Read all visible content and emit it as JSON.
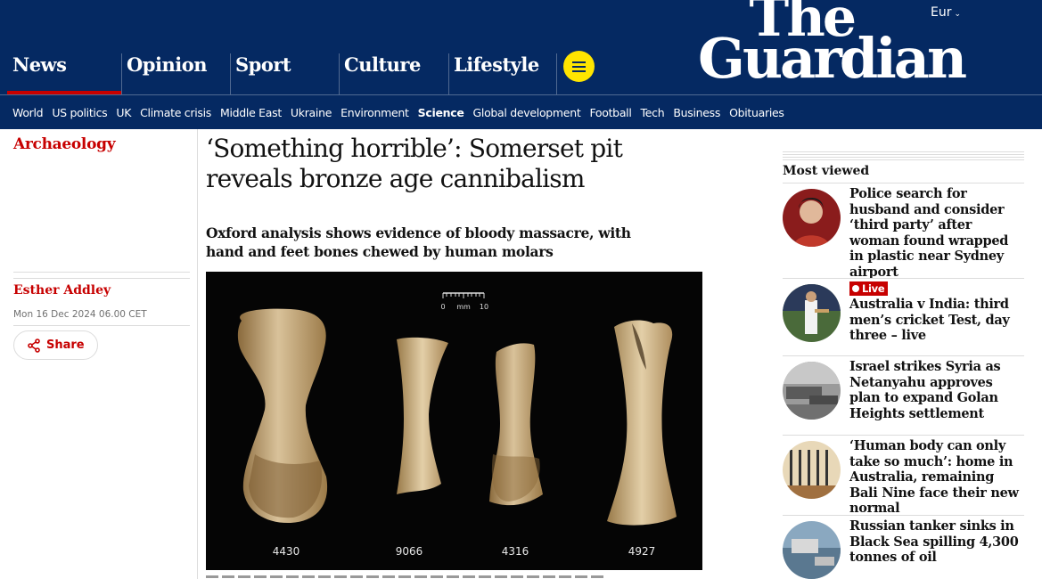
{
  "header": {
    "pillars": [
      "News",
      "Opinion",
      "Sport",
      "Culture",
      "Lifestyle"
    ],
    "edition": "Eur",
    "logo_line1": "The",
    "logo_line2": "Guardian"
  },
  "subnav": [
    "World",
    "US politics",
    "UK",
    "Climate crisis",
    "Middle East",
    "Ukraine",
    "Environment",
    "Science",
    "Global development",
    "Football",
    "Tech",
    "Business",
    "Obituaries"
  ],
  "subnav_active": "Science",
  "article": {
    "section": "Archaeology",
    "headline": "‘Something horrible’: Somerset pit reveals bronze age cannibalism",
    "standfirst": "Oxford analysis shows evidence of bloody massacre, with hand and feet bones chewed by human molars",
    "author": "Esther Addley",
    "date": "Mon 16 Dec 2024 06.00 CET",
    "share_label": "Share",
    "image": {
      "scale_min": "0",
      "scale_unit": "mm",
      "scale_max": "10",
      "bone_labels": [
        "4430",
        "9066",
        "4316",
        "4927"
      ]
    }
  },
  "most_viewed": {
    "title": "Most viewed",
    "live_label": "Live",
    "items": [
      {
        "headline": "Police search for husband and consider ‘third party’ after woman found wrapped in plastic near Sydney airport",
        "live": false
      },
      {
        "headline": "Australia v India: third men’s cricket Test, day three – live",
        "live": true
      },
      {
        "headline": "Israel strikes Syria as Netanyahu approves plan to expand Golan Heights settlement",
        "live": false
      },
      {
        "headline": "‘Human body can only take so much’: home in Australia, remaining Bali Nine face their new normal",
        "live": false
      },
      {
        "headline": "Russian tanker sinks in Black Sea spilling 4,300 tonnes of oil",
        "live": false
      }
    ]
  },
  "colors": {
    "brand_blue": "#052962",
    "news_red": "#c70000",
    "menu_yellow": "#ffe500"
  }
}
